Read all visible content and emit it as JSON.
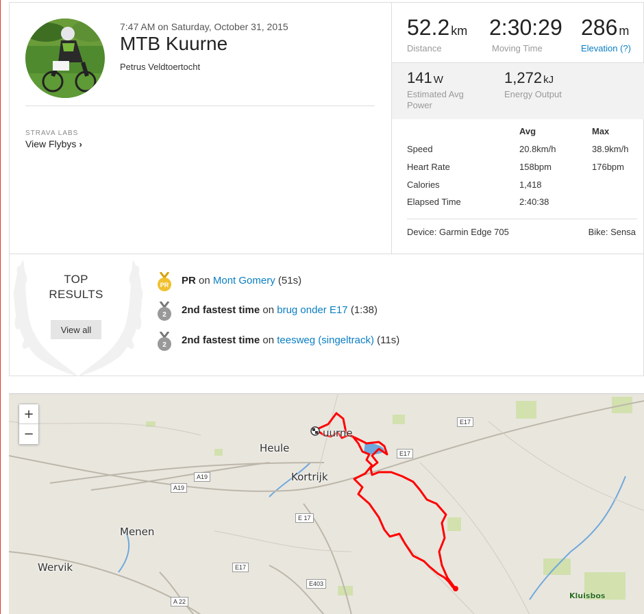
{
  "activity": {
    "datetime": "7:47 AM on Saturday, October 31, 2015",
    "title": "MTB Kuurne",
    "subtitle": "Petrus Veldtoertocht"
  },
  "labs": {
    "label": "STRAVA LABS",
    "flyby_link": "View Flybys"
  },
  "stats": {
    "distance": {
      "value": "52.2",
      "unit": "km",
      "label": "Distance"
    },
    "moving_time": {
      "value": "2:30:29",
      "label": "Moving Time"
    },
    "elevation": {
      "value": "286",
      "unit": "m",
      "label": "Elevation (?)"
    },
    "power": {
      "value": "141",
      "unit": "W",
      "label": "Estimated Avg Power"
    },
    "energy": {
      "value": "1,272",
      "unit": "kJ",
      "label": "Energy Output"
    }
  },
  "details": {
    "headers": {
      "avg": "Avg",
      "max": "Max"
    },
    "rows": [
      {
        "label": "Speed",
        "avg": "20.8km/h",
        "max": "38.9km/h"
      },
      {
        "label": "Heart Rate",
        "avg": "158bpm",
        "max": "176bpm"
      },
      {
        "label": "Calories",
        "avg": "1,418",
        "max": ""
      },
      {
        "label": "Elapsed Time",
        "avg": "2:40:38",
        "max": ""
      }
    ],
    "device": "Device: Garmin Edge 705",
    "bike": "Bike: Sensa"
  },
  "top_results": {
    "title_line1": "TOP",
    "title_line2": "RESULTS",
    "view_all": "View all",
    "items": [
      {
        "medal": "PR",
        "achievement": "PR",
        "on": "on",
        "segment": "Mont Gomery",
        "time": "(51s)"
      },
      {
        "medal": "2",
        "achievement": "2nd fastest time",
        "on": "on",
        "segment": "brug onder E17",
        "time": "(1:38)"
      },
      {
        "medal": "2",
        "achievement": "2nd fastest time",
        "on": "on",
        "segment": "teesweg (singeltrack)",
        "time": "(11s)"
      }
    ]
  },
  "map": {
    "zoom_in": "+",
    "zoom_out": "−",
    "cities": [
      "Heule",
      "Kortrijk",
      "Menen",
      "Wervik",
      "uurne"
    ],
    "roads": [
      "E17",
      "E17",
      "A19",
      "A19",
      "E 17",
      "E17",
      "E403",
      "A 22"
    ],
    "park": "Kluisbos",
    "route_color": "#ff0000"
  },
  "colors": {
    "link": "#0a7ec2",
    "gold_medal": "#f0c030",
    "silver_medal": "#999999",
    "route": "#ff0000",
    "map_bg": "#e9e6de"
  }
}
